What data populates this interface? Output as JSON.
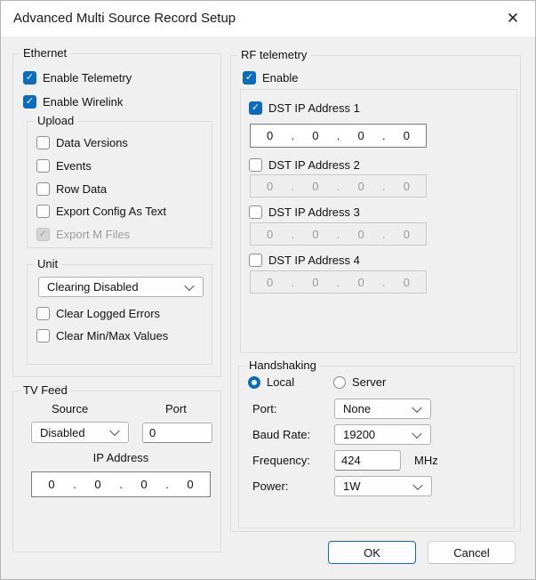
{
  "window": {
    "title": "Advanced Multi Source Record Setup"
  },
  "glyphs": {
    "check": "✓",
    "close": "✕"
  },
  "colors": {
    "accent": "#0b6cbd",
    "dialog_bg": "#f0f0f0",
    "titlebar_bg": "#ffffff",
    "disabled_text": "#9d9d9d"
  },
  "ethernet": {
    "title": "Ethernet",
    "enable_telemetry": {
      "label": "Enable Telemetry",
      "checked": true
    },
    "enable_wirelink": {
      "label": "Enable Wirelink",
      "checked": true
    },
    "upload": {
      "title": "Upload",
      "items": [
        {
          "label": "Data Versions",
          "state": "unchecked"
        },
        {
          "label": "Events",
          "state": "unchecked"
        },
        {
          "label": "Row Data",
          "state": "unchecked"
        },
        {
          "label": "Export Config As Text",
          "state": "unchecked"
        },
        {
          "label": "Export M Files",
          "state": "checked-disabled"
        }
      ]
    },
    "unit": {
      "title": "Unit",
      "clearing_value": "Clearing Disabled",
      "clear_logged_errors": {
        "label": "Clear Logged Errors",
        "checked": false
      },
      "clear_minmax": {
        "label": "Clear Min/Max Values",
        "checked": false
      }
    }
  },
  "tv_feed": {
    "title": "TV Feed",
    "source_label": "Source",
    "source_value": "Disabled",
    "port_label": "Port",
    "port_value": "0",
    "ip_label": "IP Address",
    "ip": {
      "octets": [
        "0",
        "0",
        "0",
        "0"
      ],
      "sep": "."
    }
  },
  "rf": {
    "title": "RF telemetry",
    "enable": {
      "label": "Enable",
      "checked": true
    },
    "dst": [
      {
        "label": "DST IP Address 1",
        "checked": true,
        "enabled": true,
        "ip": {
          "octets": [
            "0",
            "0",
            "0",
            "0"
          ],
          "sep": "."
        }
      },
      {
        "label": "DST IP Address 2",
        "checked": false,
        "enabled": false,
        "ip": {
          "octets": [
            "0",
            "0",
            "0",
            "0"
          ],
          "sep": "."
        }
      },
      {
        "label": "DST IP Address 3",
        "checked": false,
        "enabled": false,
        "ip": {
          "octets": [
            "0",
            "0",
            "0",
            "0"
          ],
          "sep": "."
        }
      },
      {
        "label": "DST IP Address 4",
        "checked": false,
        "enabled": false,
        "ip": {
          "octets": [
            "0",
            "0",
            "0",
            "0"
          ],
          "sep": "."
        }
      }
    ]
  },
  "handshaking": {
    "title": "Handshaking",
    "local": {
      "label": "Local",
      "selected": true
    },
    "server": {
      "label": "Server",
      "selected": false
    },
    "port_label": "Port:",
    "port_value": "None",
    "baud_label": "Baud Rate:",
    "baud_value": "19200",
    "freq_label": "Frequency:",
    "freq_value": "424",
    "freq_unit": "MHz",
    "power_label": "Power:",
    "power_value": "1W"
  },
  "buttons": {
    "ok": "OK",
    "cancel": "Cancel"
  }
}
